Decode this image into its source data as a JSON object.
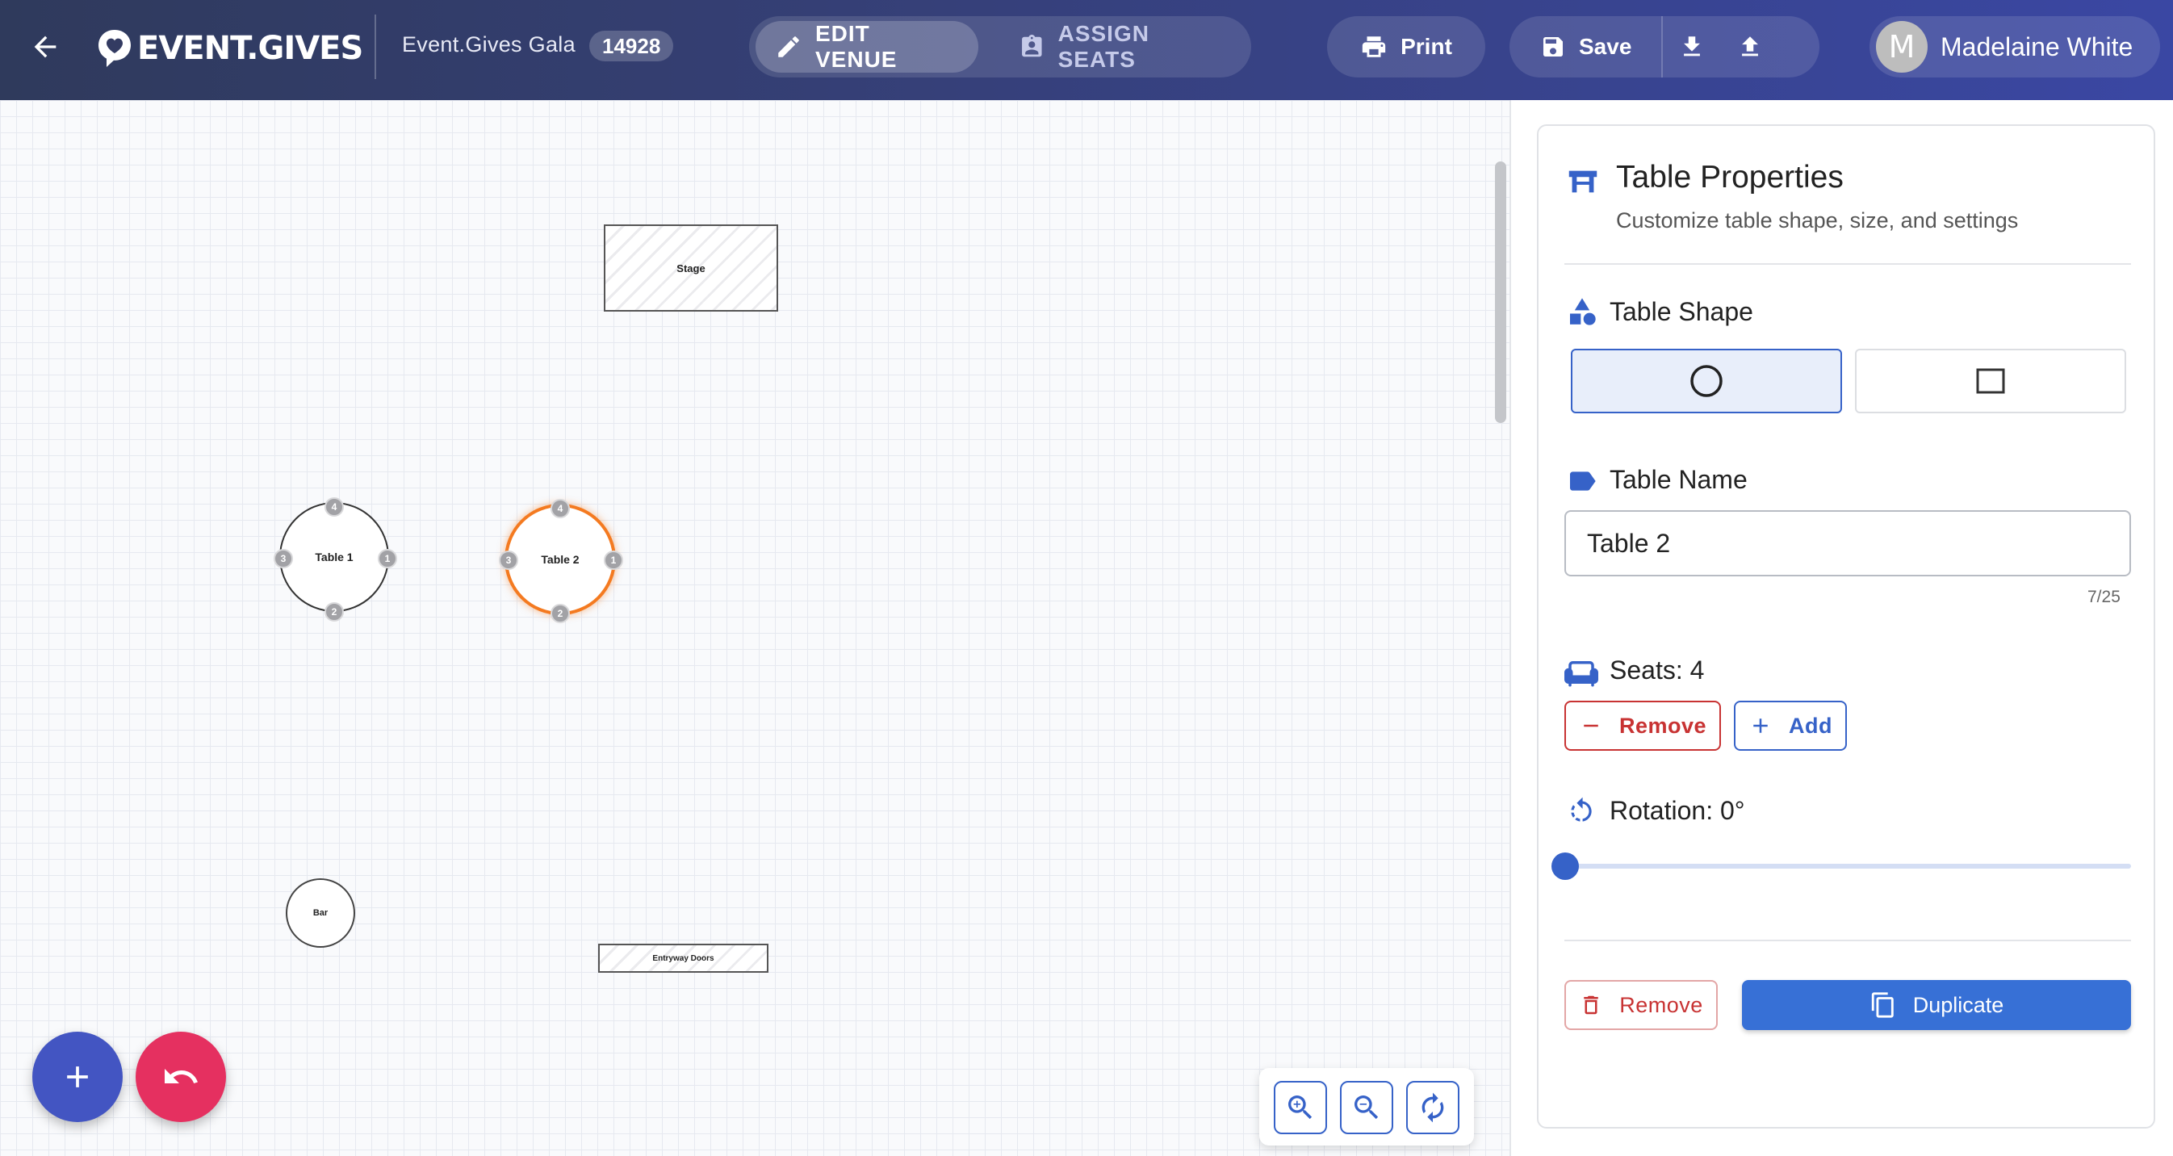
{
  "header": {
    "logo_text": "EVENT.GIVES",
    "event_name": "Event.Gives Gala",
    "event_id": "14928",
    "modes": [
      {
        "label": "EDIT VENUE",
        "icon": "pencil-icon",
        "active": true
      },
      {
        "label": "ASSIGN SEATS",
        "icon": "assign-seats-icon",
        "active": false
      }
    ],
    "print_label": "Print",
    "save_label": "Save",
    "user": {
      "name": "Madelaine White",
      "initial": "M"
    }
  },
  "canvas": {
    "stage_label": "Stage",
    "doors_label": "Entryway Doors",
    "bar_label": "Bar",
    "tables": [
      {
        "name": "Table 1",
        "selected": false,
        "seats": [
          "1",
          "2",
          "3",
          "4"
        ]
      },
      {
        "name": "Table 2",
        "selected": true,
        "seats": [
          "1",
          "2",
          "3",
          "4"
        ]
      }
    ],
    "selection_color": "#f47a20"
  },
  "panel": {
    "title": "Table Properties",
    "subtitle": "Customize table shape, size, and settings",
    "shape_label": "Table Shape",
    "shapes": [
      {
        "name": "circle",
        "selected": true
      },
      {
        "name": "square",
        "selected": false
      }
    ],
    "name_label": "Table Name",
    "name_value": "Table 2",
    "char_count": "7/25",
    "seats_label": "Seats: 4",
    "remove_seat_label": "Remove",
    "add_seat_label": "Add",
    "rotation_label": "Rotation: 0°",
    "rotation_value": 0,
    "delete_label": "Remove",
    "duplicate_label": "Duplicate"
  },
  "colors": {
    "primary": "#3662c8",
    "danger": "#c83333",
    "fab_add": "#4355c2",
    "fab_undo": "#e53060"
  }
}
